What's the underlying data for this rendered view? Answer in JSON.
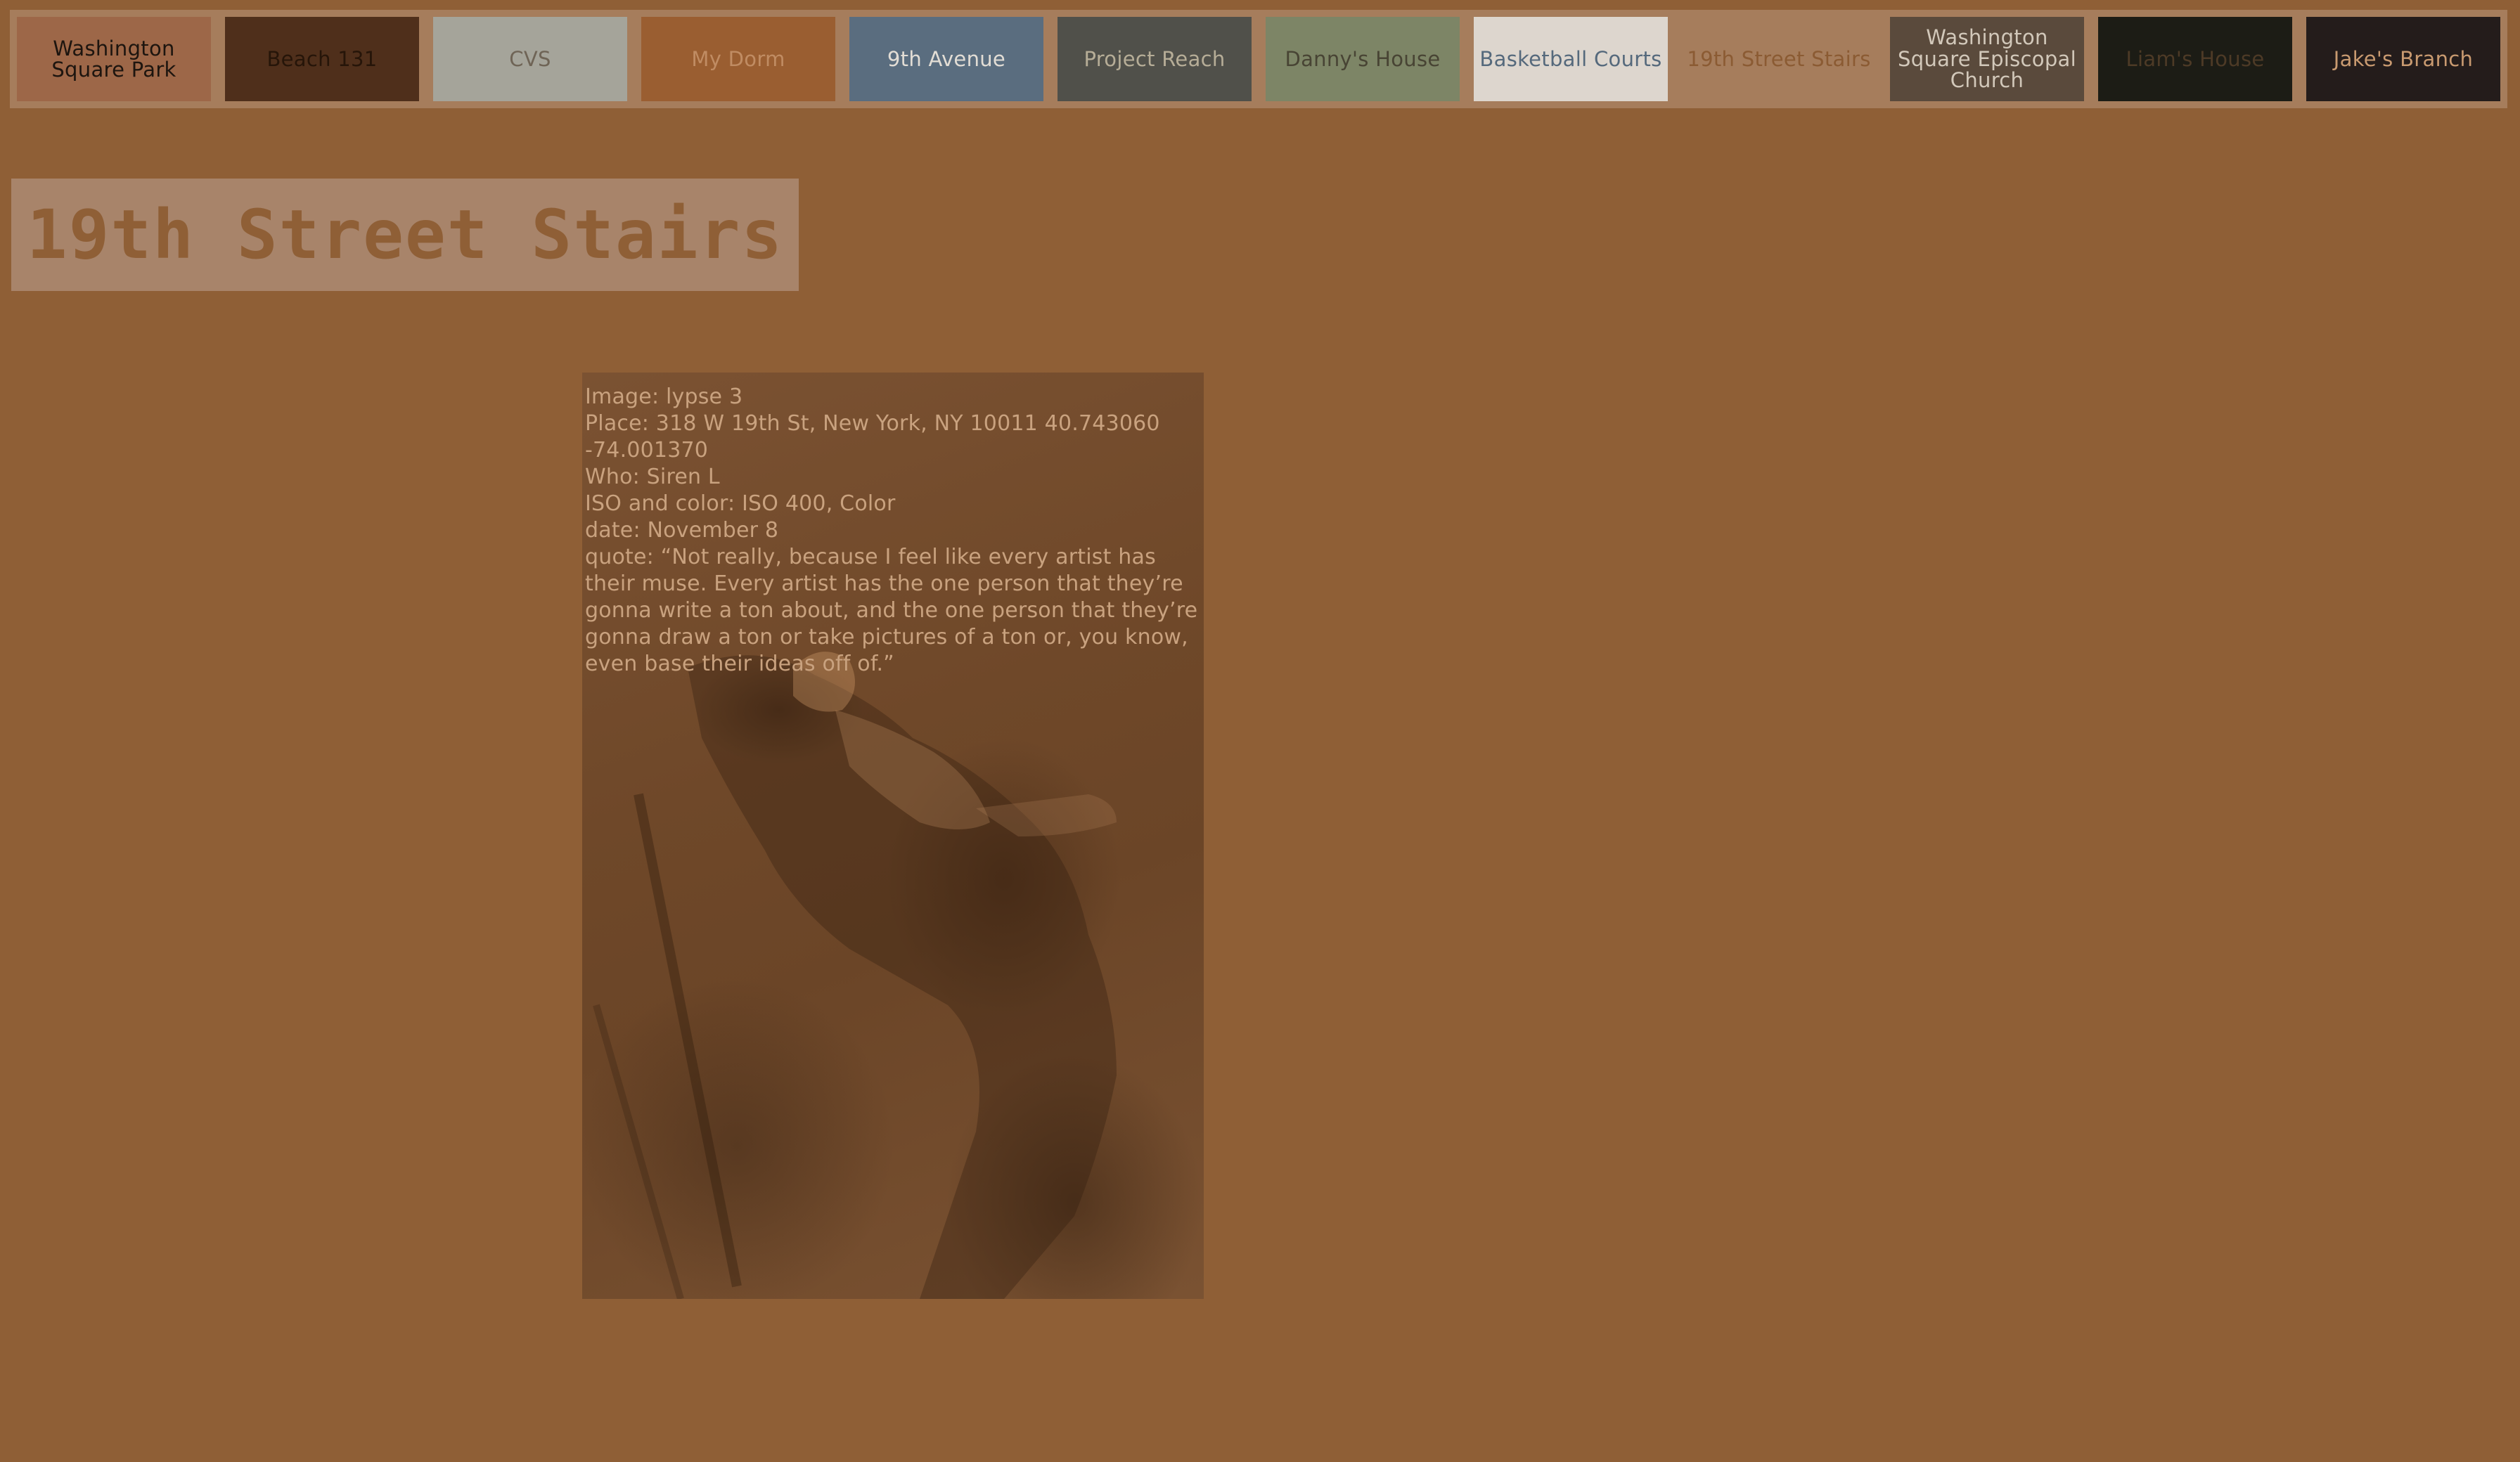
{
  "nav": {
    "items": [
      {
        "label": "Washington Square Park",
        "bg": "#9d6748",
        "fg": "#1d150f"
      },
      {
        "label": "Beach 131",
        "bg": "#4f2f1b",
        "fg": "#261509"
      },
      {
        "label": "CVS",
        "bg": "#a5a49a",
        "fg": "#6f6456"
      },
      {
        "label": "My Dorm",
        "bg": "#9a5e31",
        "fg": "#c08c63"
      },
      {
        "label": "9th Avenue",
        "bg": "#5a6d7f",
        "fg": "#e2ddd5"
      },
      {
        "label": "Project Reach",
        "bg": "#50504a",
        "fg": "#b6ad97"
      },
      {
        "label": "Danny's House",
        "bg": "#7d8566",
        "fg": "#484434"
      },
      {
        "label": "Basketball Courts",
        "bg": "#ddd6ce",
        "fg": "#55697c"
      },
      {
        "label": "19th Street Stairs",
        "bg": "#a67d5c",
        "fg": "#8b5b33"
      },
      {
        "label": "Washington Square Episcopal Church",
        "bg": "#5a4a3c",
        "fg": "#d2c8ba"
      },
      {
        "label": "Liam's House",
        "bg": "#1c1c15",
        "fg": "#4d3a26"
      },
      {
        "label": "Jake's Branch",
        "bg": "#241c1b",
        "fg": "#c99a70"
      }
    ]
  },
  "page": {
    "title": "19th Street Stairs"
  },
  "photo": {
    "caption": {
      "image": "Image: lypse 3",
      "place": "Place: 318 W 19th St, New York, NY 10011 40.743060 -74.001370",
      "who": "Who: Siren L",
      "iso": "ISO and color: ISO 400, Color",
      "date": "date: November 8",
      "quote": "quote: “Not really, because I feel like every artist has their muse. Every artist has the one person that they’re gonna write a ton about, and the one person that they’re gonna draw a ton or take pictures of a ton or, you know, even base their ideas off of.”"
    }
  },
  "colors": {
    "page_bg": "#8f5f36",
    "nav_bar_bg": "#a67d5c",
    "title_box_bg": "#a8846a",
    "title_text": "#8f5f36",
    "caption_text": "#c9a27f"
  }
}
